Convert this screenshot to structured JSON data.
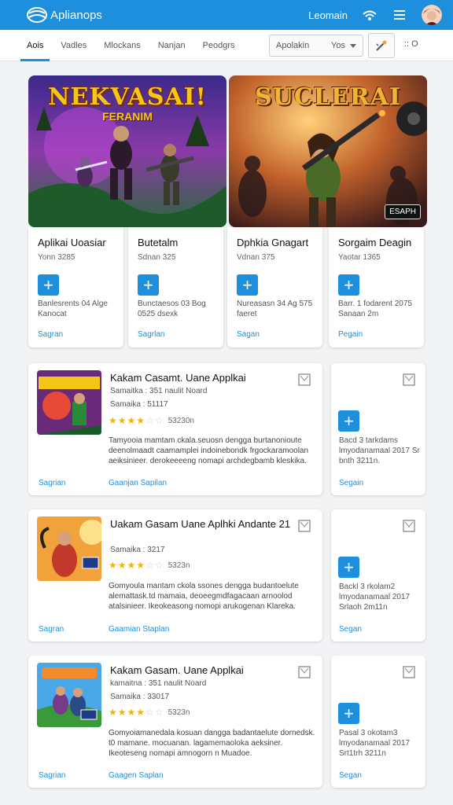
{
  "header": {
    "brand": "Aplianops",
    "link": "Leomain",
    "icons": [
      "network-icon",
      "menu-icon",
      "avatar"
    ]
  },
  "tabs": [
    {
      "label": "Aois",
      "active": true
    },
    {
      "label": "Vadles",
      "active": false
    },
    {
      "label": "Mlockans",
      "active": false
    },
    {
      "label": "Nanjan",
      "active": false
    },
    {
      "label": "Peodgrs",
      "active": false
    }
  ],
  "filter": {
    "select_label": "Apolakin",
    "select_value": "Yos",
    "extra": ":: O"
  },
  "featured": [
    {
      "title": "NEKVASAI!",
      "subtitle": "FERANIM",
      "badge": ""
    },
    {
      "title": "SUCLERAI",
      "subtitle": "",
      "badge": "ESAPH"
    }
  ],
  "apps": [
    {
      "title": "Aplikai Uoasiar",
      "sub": "Yonn 3285",
      "desc": "Banlesrents 04 Alge Kanocat",
      "link": "Sagran"
    },
    {
      "title": "Butetalm",
      "sub": "Sdnan 325",
      "desc": "Bunctaesos 03 Bog 0525 dsexk",
      "link": "Sagrlan"
    },
    {
      "title": "Dphkia Gnagart",
      "sub": "Vdnan 375",
      "desc": "Nureasasn 34 Ag 575 faeret",
      "link": "Sagan"
    },
    {
      "title": "Sorgaim Deagin",
      "sub": "Yaotar 1365",
      "desc": "Barr. 1 fodarent 2075 Sanaan 2m",
      "link": "Pegain"
    }
  ],
  "list": [
    {
      "title": "Kakam Casamt. Uane Applkai",
      "meta1": "Samaitka : 351 naulit Noard",
      "meta2": "Samaika : 51117",
      "rating": 4,
      "rating_text": "53230n",
      "desc": "Tamyooia mamtam ckala.seuosn dengga burtanonioute deenolmaadt caamamplei indoinebondk frgockaramoolan aeiksinieer. derokeeeeng nomapi archdegbamb kleskika.",
      "link1": "Sagrian",
      "link2": "Gaanjan Sapilan",
      "side_desc": "Bacd 3 tarkdams lmyodanamaal 2017 Sr bnth 3211n.",
      "side_link": "Segain"
    },
    {
      "title": "Uakam Gasam Uane Aplhki Andante  21",
      "meta1": "Samaika : 3217",
      "meta2": "",
      "rating": 4,
      "rating_text": "5323n",
      "desc": "Gomyoula mantam ckola ssones dengga budantoelute alemattask.td mamaia, deoeegmdfagacaan arnoolod atalsinieer. Ikeokeasong nomopi arukogenan Klareka.",
      "link1": "Sagran",
      "link2": "Gaamian Staplan",
      "side_desc": "Backl 3 rkolam2 lmyodanamaal 2017 Srlaoh 2m11n",
      "side_link": "Segan"
    },
    {
      "title": "Kakam Gasam. Uane Applkai",
      "meta1": "kamaitna : 351 naulit Noard",
      "meta2": "Samaika : 33017",
      "rating": 4,
      "rating_text": "5323n",
      "desc": "Gomyoiamanedala kosuan dangga badantaelute dornedsk. t0 mamane. mocuanan. lagamemaoloka aeksiner. Ikeoteseng nomapi amnogorn n Muadoe.",
      "link1": "Sagrian",
      "link2": "Gaagen Saplan",
      "side_desc": "Pasal 3 okotam3 lmyodanamaal 2017 Srt1trh 3211n",
      "side_link": "Segan"
    }
  ],
  "colors": {
    "accent": "#1e8fdc",
    "star": "#f4b400"
  }
}
